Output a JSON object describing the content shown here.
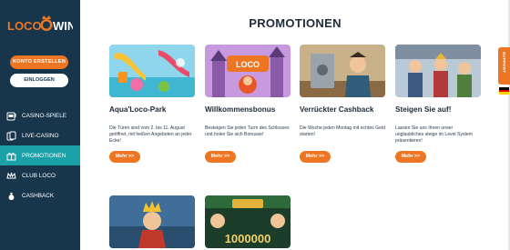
{
  "brand": {
    "logo_left": "LOCO",
    "logo_right": "WIN"
  },
  "sidebar": {
    "register_label": "KONTO ERSTELLEN",
    "login_label": "EINLOGGEN",
    "items": [
      {
        "label": "CASINO-SPIELE",
        "icon": "slot-machine-icon"
      },
      {
        "label": "LIVE-CASINO",
        "icon": "cards-icon"
      },
      {
        "label": "PROMOTIONEN",
        "icon": "gift-icon",
        "active": true
      },
      {
        "label": "CLUB LOCO",
        "icon": "crown-icon"
      },
      {
        "label": "CASHBACK",
        "icon": "money-bag-icon"
      }
    ]
  },
  "page": {
    "title": "PROMOTIONEN"
  },
  "promotions": [
    {
      "title": "Aqua'Loco-Park",
      "text": "Die Türen sind vom 2. bis 11. August geöffnet, mit heißen Angeboten an jeder Ecke!",
      "button": "Mehr >>"
    },
    {
      "title": "Willkommensbonus",
      "text": "Besteigen Sie jeden Turm des Schlosses und holen Sie sich Bonusse!",
      "button": "Mehr >>"
    },
    {
      "title": "Verrückter Cashback",
      "text": "Die Woche jeden Montag mit echtes Geld starten!",
      "button": "Mehr >>"
    },
    {
      "title": "Steigen Sie auf!",
      "text": "Lassen Sie uns Ihnen unser unglaubliches steige im Level System präsentieren!",
      "button": "Mehr >>"
    }
  ],
  "extra_banners": {
    "prize_amount": "1000000"
  },
  "side": {
    "support_label": "SUPPORT"
  },
  "colors": {
    "sidebar_bg": "#17364b",
    "accent": "#ee7623",
    "active_nav": "#1aa1a8"
  }
}
